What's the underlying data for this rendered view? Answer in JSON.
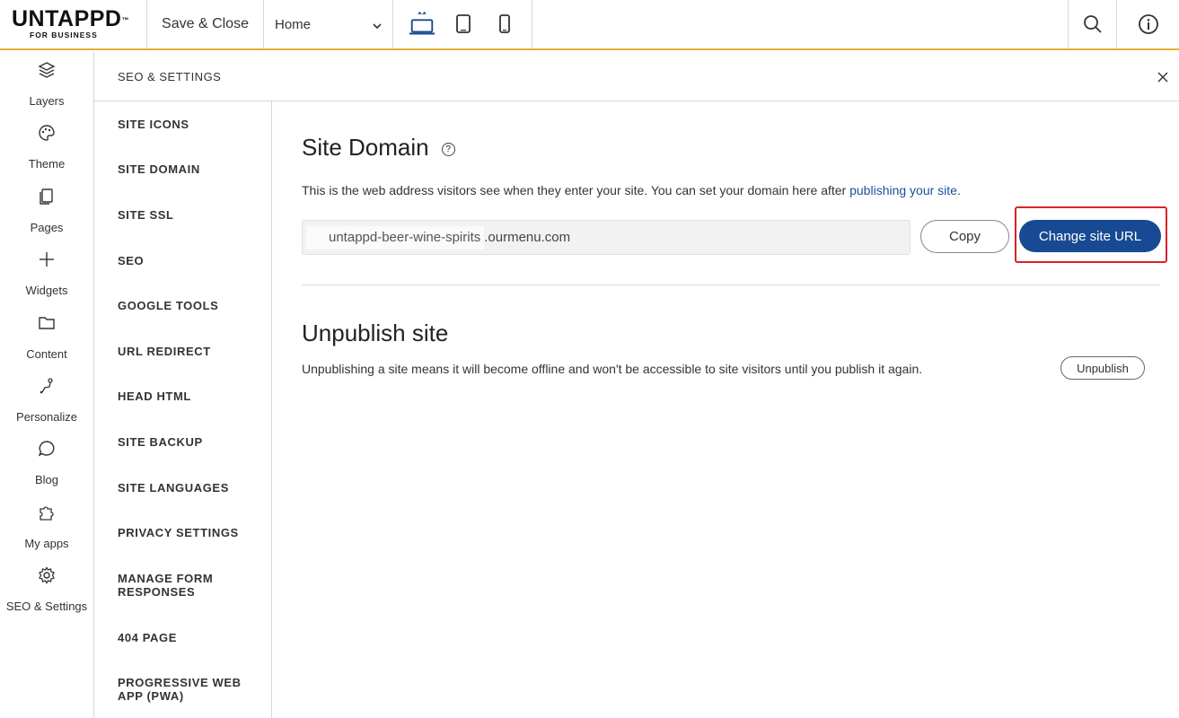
{
  "topbar": {
    "logo_main": "UNTAPPD",
    "logo_tm": "™",
    "logo_sub": "FOR BUSINESS",
    "save_close": "Save & Close",
    "page_select": "Home",
    "devices": [
      "desktop-icon",
      "tablet-icon",
      "mobile-icon"
    ],
    "active_device": "desktop",
    "right_icons": [
      "search-icon",
      "info-icon"
    ]
  },
  "rail": {
    "items": [
      {
        "label": "Layers",
        "icon": "layers-icon"
      },
      {
        "label": "Theme",
        "icon": "palette-icon"
      },
      {
        "label": "Pages",
        "icon": "pages-icon"
      },
      {
        "label": "Widgets",
        "icon": "plus-icon"
      },
      {
        "label": "Content",
        "icon": "folder-icon"
      },
      {
        "label": "Personalize",
        "icon": "personalize-icon"
      },
      {
        "label": "Blog",
        "icon": "chat-icon"
      },
      {
        "label": "My apps",
        "icon": "puzzle-icon"
      },
      {
        "label": "SEO & Settings",
        "icon": "gear-icon"
      }
    ]
  },
  "panel": {
    "title": "SEO & SETTINGS"
  },
  "settings_nav": {
    "items": [
      "SITE ICONS",
      "SITE DOMAIN",
      "SITE SSL",
      "SEO",
      "GOOGLE TOOLS",
      "URL REDIRECT",
      "HEAD HTML",
      "SITE BACKUP",
      "SITE LANGUAGES",
      "PRIVACY SETTINGS",
      "MANAGE FORM RESPONSES",
      "404 PAGE",
      "PROGRESSIVE WEB APP (PWA)"
    ]
  },
  "site_domain": {
    "heading": "Site Domain",
    "description_before": "This is the web address visitors see when they enter your site. You can set your domain here after ",
    "description_link": "publishing your site",
    "description_after": ".",
    "subdomain": "untappd-beer-wine-spirits",
    "domain_suffix": ".ourmenu.com",
    "copy_label": "Copy",
    "change_label": "Change site URL"
  },
  "unpublish": {
    "heading": "Unpublish site",
    "description": "Unpublishing a site means it will become offline and won't be accessible to site visitors until you publish it again.",
    "button_label": "Unpublish"
  },
  "colors": {
    "accent_line": "#e0b33c",
    "primary_button": "#174a93",
    "link": "#1d4fa0",
    "highlight": "#d9232a"
  }
}
